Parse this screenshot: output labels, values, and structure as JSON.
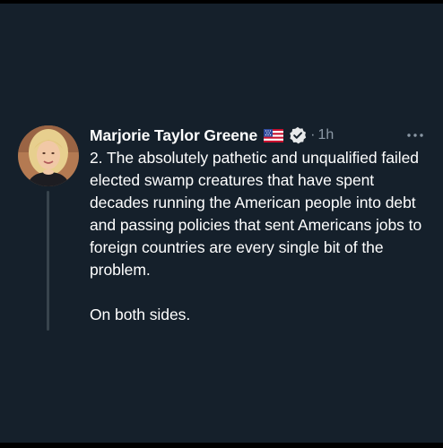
{
  "author": {
    "display_name": "Marjorie Taylor Greene",
    "flag_icon": "us-flag-icon",
    "verified_icon": "verified-badge-icon",
    "timestamp_separator": "·",
    "timestamp": "1h",
    "avatar_icon": "avatar"
  },
  "tweet": {
    "paragraphs": [
      "2. The absolutely pathetic and unqualified failed elected swamp creatures that have spent decades running the American people into debt and passing policies that sent Americans jobs to foreign countries are every single bit of the problem.",
      "On both sides."
    ]
  },
  "menu": {
    "more_icon": "more-horizontal-icon"
  },
  "colors": {
    "background": "#15202b",
    "text": "#ffffff",
    "muted": "#8b98a5",
    "thread_line": "#38444d"
  }
}
